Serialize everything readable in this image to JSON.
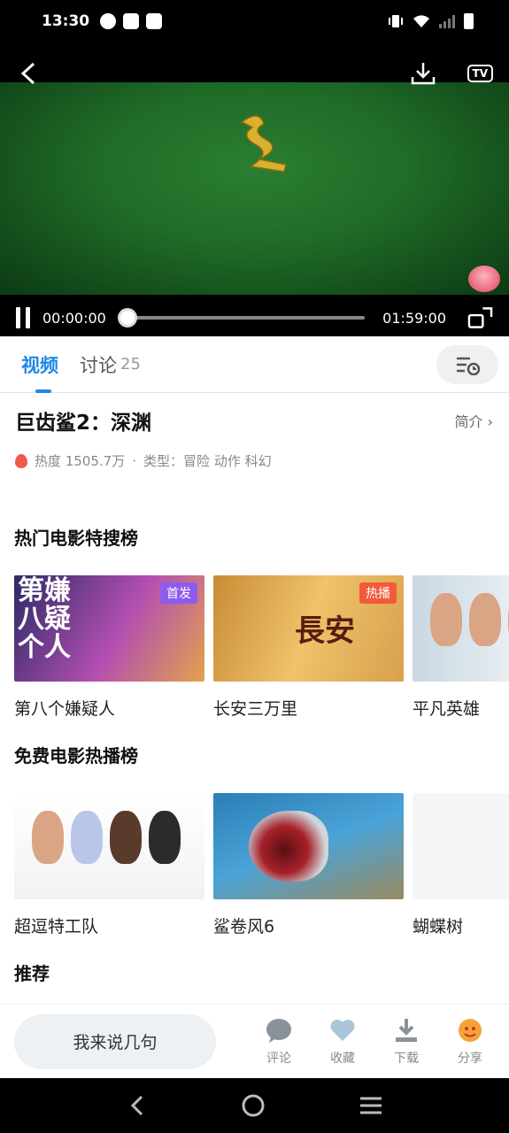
{
  "status_bar": {
    "time": "13:30"
  },
  "player": {
    "current_time": "00:00:00",
    "duration": "01:59:00",
    "progress": 0,
    "cast_label": "TV"
  },
  "tabs": [
    {
      "label": "视频"
    },
    {
      "label": "讨论",
      "count": "25"
    }
  ],
  "movie": {
    "title": "巨齿鲨2：深渊",
    "intro_label": "简介",
    "heat": "热度 1505.7万",
    "separator": "·",
    "genre": "类型：冒险 动作 科幻"
  },
  "sections": {
    "hot_search": {
      "title": "热门电影特搜榜",
      "items": [
        {
          "title": "第八个嫌疑人",
          "tag": "首发",
          "tag_color": "#8e5bf0",
          "poster_text": "第嫌八疑个人"
        },
        {
          "title": "长安三万里",
          "tag": "热播",
          "tag_color": "#f25a3a",
          "poster_text": "長安"
        },
        {
          "title": "平凡英雄"
        }
      ]
    },
    "free_hot": {
      "title": "免费电影热播榜",
      "items": [
        {
          "title": "超逗特工队"
        },
        {
          "title": "鲨卷风6"
        },
        {
          "title": "蝴蝶树"
        }
      ]
    },
    "recommend": {
      "title": "推荐"
    }
  },
  "bottom_bar": {
    "comment_placeholder": "我来说几句",
    "actions": [
      {
        "label": "评论",
        "icon": "comment-icon"
      },
      {
        "label": "收藏",
        "icon": "heart-icon"
      },
      {
        "label": "下载",
        "icon": "download-icon"
      },
      {
        "label": "分享",
        "icon": "share-icon"
      }
    ]
  },
  "colors": {
    "accent": "#1e88e5",
    "video_bg": "#1f6a27",
    "flame": "#f05a4a"
  }
}
